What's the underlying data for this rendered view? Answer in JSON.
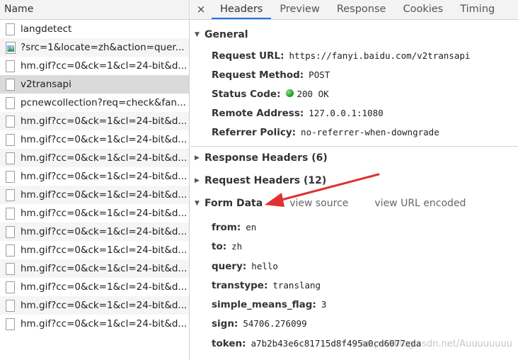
{
  "requests_panel": {
    "header": "Name",
    "items": [
      {
        "name": "langdetect",
        "icon": "file-icon"
      },
      {
        "name": "?src=1&locate=zh&action=quer...",
        "icon": "image-icon"
      },
      {
        "name": "hm.gif?cc=0&ck=1&cl=24-bit&d...",
        "icon": "file-icon"
      },
      {
        "name": "v2transapi",
        "icon": "file-icon",
        "selected": true
      },
      {
        "name": "pcnewcollection?req=check&fan...",
        "icon": "file-icon"
      },
      {
        "name": "hm.gif?cc=0&ck=1&cl=24-bit&d...",
        "icon": "file-icon"
      },
      {
        "name": "hm.gif?cc=0&ck=1&cl=24-bit&d...",
        "icon": "file-icon"
      },
      {
        "name": "hm.gif?cc=0&ck=1&cl=24-bit&d...",
        "icon": "file-icon"
      },
      {
        "name": "hm.gif?cc=0&ck=1&cl=24-bit&d...",
        "icon": "file-icon"
      },
      {
        "name": "hm.gif?cc=0&ck=1&cl=24-bit&d...",
        "icon": "file-icon"
      },
      {
        "name": "hm.gif?cc=0&ck=1&cl=24-bit&d...",
        "icon": "file-icon"
      },
      {
        "name": "hm.gif?cc=0&ck=1&cl=24-bit&d...",
        "icon": "file-icon"
      },
      {
        "name": "hm.gif?cc=0&ck=1&cl=24-bit&d...",
        "icon": "file-icon"
      },
      {
        "name": "hm.gif?cc=0&ck=1&cl=24-bit&d...",
        "icon": "file-icon"
      },
      {
        "name": "hm.gif?cc=0&ck=1&cl=24-bit&d...",
        "icon": "file-icon"
      },
      {
        "name": "hm.gif?cc=0&ck=1&cl=24-bit&d...",
        "icon": "file-icon"
      },
      {
        "name": "hm.gif?cc=0&ck=1&cl=24-bit&d...",
        "icon": "file-icon"
      }
    ]
  },
  "tabs": {
    "close": "×",
    "items": [
      "Headers",
      "Preview",
      "Response",
      "Cookies",
      "Timing"
    ],
    "active": "Headers"
  },
  "general": {
    "title": "General",
    "request_url_label": "Request URL:",
    "request_url": "https://fanyi.baidu.com/v2transapi",
    "request_method_label": "Request Method:",
    "request_method": "POST",
    "status_code_label": "Status Code:",
    "status_code": "200 OK",
    "remote_address_label": "Remote Address:",
    "remote_address": "127.0.0.1:1080",
    "referrer_policy_label": "Referrer Policy:",
    "referrer_policy": "no-referrer-when-downgrade"
  },
  "response_headers": {
    "title": "Response Headers (6)"
  },
  "request_headers": {
    "title": "Request Headers (12)"
  },
  "form_data": {
    "title": "Form Data",
    "view_source": "view source",
    "view_url_encoded": "view URL encoded",
    "fields": [
      {
        "key": "from:",
        "value": "en"
      },
      {
        "key": "to:",
        "value": "zh"
      },
      {
        "key": "query:",
        "value": "hello"
      },
      {
        "key": "transtype:",
        "value": "translang"
      },
      {
        "key": "simple_means_flag:",
        "value": "3"
      },
      {
        "key": "sign:",
        "value": "54706.276099"
      },
      {
        "key": "token:",
        "value": "a7b2b43e6c81715d8f495a0cd6077eda"
      }
    ]
  },
  "watermark": "https://blog.csdn.net/Auuuuuuuu",
  "colors": {
    "arrow": "#e03030",
    "tab_active_underline": "#1a73e8",
    "status_ok": "#1aa31a"
  }
}
